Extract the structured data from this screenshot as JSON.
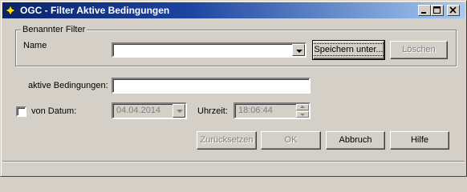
{
  "window": {
    "title": "OGC - Filter Aktive Bedingungen"
  },
  "named_filter": {
    "group_label": "Benannter Filter",
    "name_label": "Name",
    "name_value": "",
    "save_button": "Speichern unter...",
    "delete_button": "Löschen"
  },
  "active_conditions": {
    "label": "aktive Bedingungen:",
    "value": ""
  },
  "from_date": {
    "checkbox_label": "von Datum:",
    "checked": false,
    "date_value": "04.04.2014",
    "time_label": "Uhrzeit:",
    "time_value": "18:06:44"
  },
  "buttons": {
    "reset": "Zurücksetzen",
    "ok": "OK",
    "cancel": "Abbruch",
    "help": "Hilfe"
  }
}
